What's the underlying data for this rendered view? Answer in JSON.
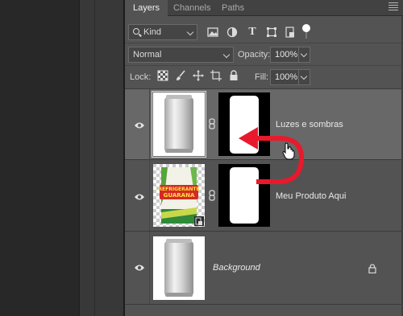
{
  "tabs": [
    {
      "label": "Layers",
      "active": true
    },
    {
      "label": "Channels",
      "active": false
    },
    {
      "label": "Paths",
      "active": false
    }
  ],
  "filter": {
    "kind_label": "Kind",
    "icons": [
      "pixel-filter-icon",
      "adjustment-filter-icon",
      "type-filter-icon",
      "shape-filter-icon",
      "smart-object-filter-icon"
    ]
  },
  "blend": {
    "mode": "Normal",
    "opacity_label": "Opacity:",
    "opacity_value": "100%"
  },
  "lock": {
    "label": "Lock:",
    "fill_label": "Fill:",
    "fill_value": "100%"
  },
  "layers": [
    {
      "name": "Luzes e sombras",
      "visible": true,
      "selected": true,
      "has_mask": true,
      "italic": false
    },
    {
      "name": "Meu Produto Aqui",
      "visible": true,
      "selected": false,
      "has_mask": true,
      "smart_object": true,
      "italic": false
    },
    {
      "name": "Background",
      "visible": true,
      "selected": false,
      "has_mask": false,
      "locked": true,
      "italic": true
    }
  ],
  "product_label": {
    "line1": "REFRIGERANTE",
    "line2": "GUARANA"
  },
  "colors": {
    "panel_bg": "#535353",
    "selected_row": "#686868",
    "annotation_arrow": "#e8192c"
  }
}
